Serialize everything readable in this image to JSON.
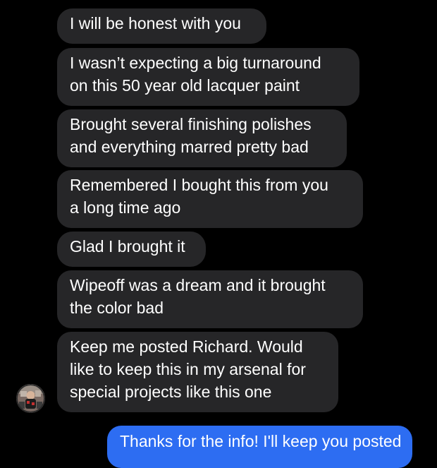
{
  "messages": {
    "incoming": [
      {
        "lines": [
          "I will be honest with you"
        ]
      },
      {
        "lines": [
          "I wasn’t expecting a big turnaround",
          "on this 50 year old lacquer paint"
        ]
      },
      {
        "lines": [
          "Brought several finishing polishes",
          "and everything marred pretty bad"
        ]
      },
      {
        "lines": [
          "Remembered I bought this from you",
          "a long time ago"
        ]
      },
      {
        "lines": [
          "Glad I brought it"
        ]
      },
      {
        "lines": [
          "Wipeoff was a dream and it brought",
          "the color bad"
        ]
      },
      {
        "lines": [
          "Keep me posted Richard.  Would",
          "like to keep this in my arsenal for",
          "special projects like this one"
        ]
      }
    ],
    "outgoing": [
      {
        "lines": [
          "Thanks for the info! I'll keep you posted"
        ]
      }
    ]
  },
  "colors": {
    "background": "#000000",
    "incoming_bubble": "#262628",
    "outgoing_bubble": "#2d6df2",
    "text": "#ffffff"
  },
  "sender": {
    "avatar_icon": "contact-avatar-icon"
  }
}
